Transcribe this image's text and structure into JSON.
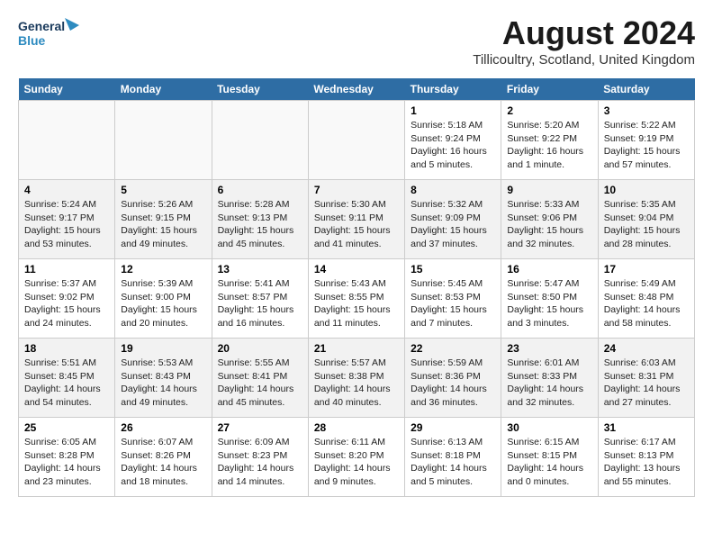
{
  "logo": {
    "line1": "General",
    "line2": "Blue"
  },
  "title": "August 2024",
  "location": "Tillicoultry, Scotland, United Kingdom",
  "days_of_week": [
    "Sunday",
    "Monday",
    "Tuesday",
    "Wednesday",
    "Thursday",
    "Friday",
    "Saturday"
  ],
  "weeks": [
    [
      {
        "day": "",
        "info": ""
      },
      {
        "day": "",
        "info": ""
      },
      {
        "day": "",
        "info": ""
      },
      {
        "day": "",
        "info": ""
      },
      {
        "day": "1",
        "info": "Sunrise: 5:18 AM\nSunset: 9:24 PM\nDaylight: 16 hours\nand 5 minutes."
      },
      {
        "day": "2",
        "info": "Sunrise: 5:20 AM\nSunset: 9:22 PM\nDaylight: 16 hours\nand 1 minute."
      },
      {
        "day": "3",
        "info": "Sunrise: 5:22 AM\nSunset: 9:19 PM\nDaylight: 15 hours\nand 57 minutes."
      }
    ],
    [
      {
        "day": "4",
        "info": "Sunrise: 5:24 AM\nSunset: 9:17 PM\nDaylight: 15 hours\nand 53 minutes."
      },
      {
        "day": "5",
        "info": "Sunrise: 5:26 AM\nSunset: 9:15 PM\nDaylight: 15 hours\nand 49 minutes."
      },
      {
        "day": "6",
        "info": "Sunrise: 5:28 AM\nSunset: 9:13 PM\nDaylight: 15 hours\nand 45 minutes."
      },
      {
        "day": "7",
        "info": "Sunrise: 5:30 AM\nSunset: 9:11 PM\nDaylight: 15 hours\nand 41 minutes."
      },
      {
        "day": "8",
        "info": "Sunrise: 5:32 AM\nSunset: 9:09 PM\nDaylight: 15 hours\nand 37 minutes."
      },
      {
        "day": "9",
        "info": "Sunrise: 5:33 AM\nSunset: 9:06 PM\nDaylight: 15 hours\nand 32 minutes."
      },
      {
        "day": "10",
        "info": "Sunrise: 5:35 AM\nSunset: 9:04 PM\nDaylight: 15 hours\nand 28 minutes."
      }
    ],
    [
      {
        "day": "11",
        "info": "Sunrise: 5:37 AM\nSunset: 9:02 PM\nDaylight: 15 hours\nand 24 minutes."
      },
      {
        "day": "12",
        "info": "Sunrise: 5:39 AM\nSunset: 9:00 PM\nDaylight: 15 hours\nand 20 minutes."
      },
      {
        "day": "13",
        "info": "Sunrise: 5:41 AM\nSunset: 8:57 PM\nDaylight: 15 hours\nand 16 minutes."
      },
      {
        "day": "14",
        "info": "Sunrise: 5:43 AM\nSunset: 8:55 PM\nDaylight: 15 hours\nand 11 minutes."
      },
      {
        "day": "15",
        "info": "Sunrise: 5:45 AM\nSunset: 8:53 PM\nDaylight: 15 hours\nand 7 minutes."
      },
      {
        "day": "16",
        "info": "Sunrise: 5:47 AM\nSunset: 8:50 PM\nDaylight: 15 hours\nand 3 minutes."
      },
      {
        "day": "17",
        "info": "Sunrise: 5:49 AM\nSunset: 8:48 PM\nDaylight: 14 hours\nand 58 minutes."
      }
    ],
    [
      {
        "day": "18",
        "info": "Sunrise: 5:51 AM\nSunset: 8:45 PM\nDaylight: 14 hours\nand 54 minutes."
      },
      {
        "day": "19",
        "info": "Sunrise: 5:53 AM\nSunset: 8:43 PM\nDaylight: 14 hours\nand 49 minutes."
      },
      {
        "day": "20",
        "info": "Sunrise: 5:55 AM\nSunset: 8:41 PM\nDaylight: 14 hours\nand 45 minutes."
      },
      {
        "day": "21",
        "info": "Sunrise: 5:57 AM\nSunset: 8:38 PM\nDaylight: 14 hours\nand 40 minutes."
      },
      {
        "day": "22",
        "info": "Sunrise: 5:59 AM\nSunset: 8:36 PM\nDaylight: 14 hours\nand 36 minutes."
      },
      {
        "day": "23",
        "info": "Sunrise: 6:01 AM\nSunset: 8:33 PM\nDaylight: 14 hours\nand 32 minutes."
      },
      {
        "day": "24",
        "info": "Sunrise: 6:03 AM\nSunset: 8:31 PM\nDaylight: 14 hours\nand 27 minutes."
      }
    ],
    [
      {
        "day": "25",
        "info": "Sunrise: 6:05 AM\nSunset: 8:28 PM\nDaylight: 14 hours\nand 23 minutes."
      },
      {
        "day": "26",
        "info": "Sunrise: 6:07 AM\nSunset: 8:26 PM\nDaylight: 14 hours\nand 18 minutes."
      },
      {
        "day": "27",
        "info": "Sunrise: 6:09 AM\nSunset: 8:23 PM\nDaylight: 14 hours\nand 14 minutes."
      },
      {
        "day": "28",
        "info": "Sunrise: 6:11 AM\nSunset: 8:20 PM\nDaylight: 14 hours\nand 9 minutes."
      },
      {
        "day": "29",
        "info": "Sunrise: 6:13 AM\nSunset: 8:18 PM\nDaylight: 14 hours\nand 5 minutes."
      },
      {
        "day": "30",
        "info": "Sunrise: 6:15 AM\nSunset: 8:15 PM\nDaylight: 14 hours\nand 0 minutes."
      },
      {
        "day": "31",
        "info": "Sunrise: 6:17 AM\nSunset: 8:13 PM\nDaylight: 13 hours\nand 55 minutes."
      }
    ]
  ]
}
